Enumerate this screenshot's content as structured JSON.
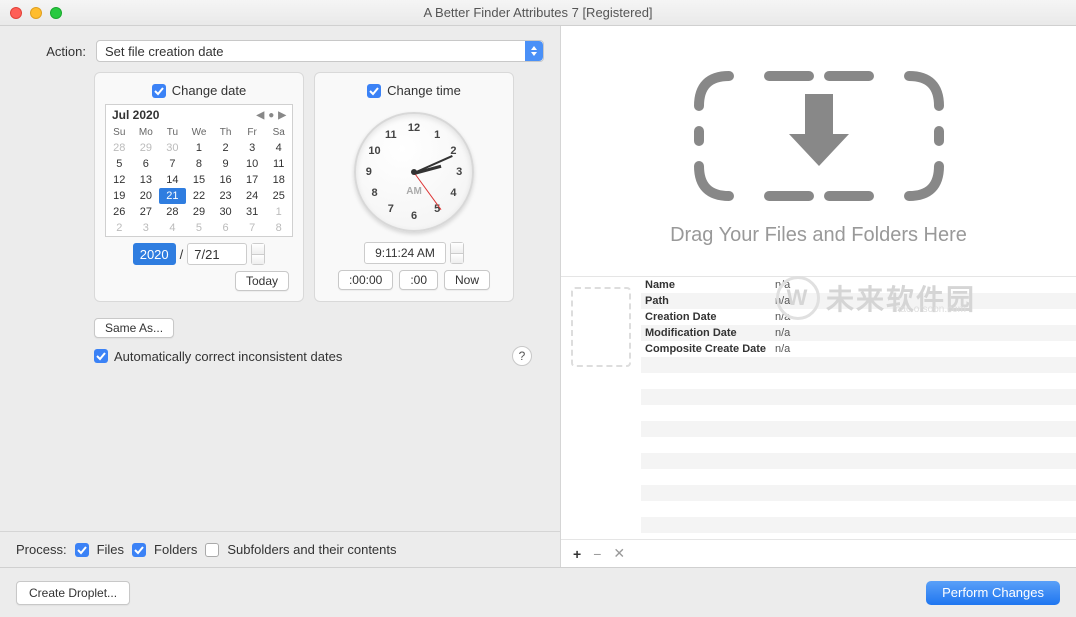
{
  "window": {
    "title": "A Better Finder Attributes 7 [Registered]"
  },
  "action": {
    "label": "Action:",
    "value": "Set file creation date"
  },
  "changeDate": {
    "label": "Change date",
    "monthYear": "Jul 2020",
    "dow": [
      "Su",
      "Mo",
      "Tu",
      "We",
      "Th",
      "Fr",
      "Sa"
    ],
    "weeks": [
      [
        {
          "d": "28",
          "o": true
        },
        {
          "d": "29",
          "o": true
        },
        {
          "d": "30",
          "o": true
        },
        {
          "d": "1"
        },
        {
          "d": "2"
        },
        {
          "d": "3"
        },
        {
          "d": "4"
        }
      ],
      [
        {
          "d": "5"
        },
        {
          "d": "6"
        },
        {
          "d": "7"
        },
        {
          "d": "8"
        },
        {
          "d": "9"
        },
        {
          "d": "10"
        },
        {
          "d": "11"
        }
      ],
      [
        {
          "d": "12"
        },
        {
          "d": "13"
        },
        {
          "d": "14"
        },
        {
          "d": "15"
        },
        {
          "d": "16"
        },
        {
          "d": "17"
        },
        {
          "d": "18"
        }
      ],
      [
        {
          "d": "19"
        },
        {
          "d": "20"
        },
        {
          "d": "21",
          "sel": true
        },
        {
          "d": "22"
        },
        {
          "d": "23"
        },
        {
          "d": "24"
        },
        {
          "d": "25"
        }
      ],
      [
        {
          "d": "26"
        },
        {
          "d": "27"
        },
        {
          "d": "28"
        },
        {
          "d": "29"
        },
        {
          "d": "30"
        },
        {
          "d": "31"
        },
        {
          "d": "1",
          "o": true
        }
      ],
      [
        {
          "d": "2",
          "o": true
        },
        {
          "d": "3",
          "o": true
        },
        {
          "d": "4",
          "o": true
        },
        {
          "d": "5",
          "o": true
        },
        {
          "d": "6",
          "o": true
        },
        {
          "d": "7",
          "o": true
        },
        {
          "d": "8",
          "o": true
        }
      ]
    ],
    "yearField": "2020",
    "mdField": "7/21",
    "todayBtn": "Today"
  },
  "changeTime": {
    "label": "Change time",
    "timeField": "9:11:24 AM",
    "ampm": "AM",
    "btn1": ":00:00",
    "btn2": ":00",
    "btn3": "Now"
  },
  "sameAsBtn": "Same As...",
  "autoCorrect": "Automatically correct inconsistent dates",
  "process": {
    "label": "Process:",
    "files": "Files",
    "folders": "Folders",
    "subfolders": "Subfolders and their contents"
  },
  "dropzone": {
    "text": "Drag Your Files and Folders Here"
  },
  "properties": [
    {
      "key": "Name",
      "val": "n/a"
    },
    {
      "key": "Path",
      "val": "n/a"
    },
    {
      "key": "Creation Date",
      "val": "n/a"
    },
    {
      "key": "Modification Date",
      "val": "n/a"
    },
    {
      "key": "Composite Create Date",
      "val": "n/a"
    }
  ],
  "footer": {
    "createDroplet": "Create Droplet...",
    "perform": "Perform Changes"
  },
  "watermark": {
    "main": "未来软件园",
    "sub": "mac.orsoon.com"
  }
}
